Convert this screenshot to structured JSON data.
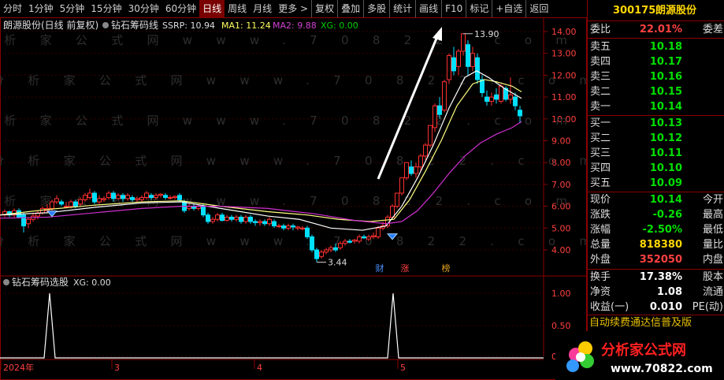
{
  "toolbar": {
    "items": [
      "分时",
      "1分钟",
      "5分钟",
      "15分钟",
      "30分钟",
      "60分钟",
      "日线",
      "周线",
      "月线",
      "更多 >",
      "复权",
      "叠加",
      "多股",
      "统计",
      "画线",
      "F10",
      "标记",
      "+自选",
      "返回"
    ],
    "active": "日线"
  },
  "chart": {
    "header_name": "朗源股份(日线 前复权)",
    "indicator_name": "钻石筹码线",
    "ssrp_label": "SSRP: 10.94",
    "ma1_label": "MA1: 11.24",
    "ma2_label": "MA2: 9.88",
    "xg_label": "XG: 0.00",
    "price_axis": [
      "14.00",
      "13.00",
      "12.00",
      "11.00",
      "10.00",
      "9.00",
      "8.00",
      "7.00",
      "6.00",
      "5.00",
      "4.00"
    ],
    "high_annotation": "13.90",
    "low_annotation": "3.44",
    "event_markers": [
      "财",
      "涨",
      "榜"
    ],
    "watermark": "分析家公式网www.70822.com",
    "colors": {
      "up": "#ff3030",
      "down": "#00e0ff",
      "ma1": "#ffffff",
      "ma2": "#ffff80",
      "ssrp": "#d030d0"
    }
  },
  "sub_chart": {
    "title": "钻石筹码选股",
    "xg_label": "XG: 0.00",
    "axis": [
      "1.00",
      "0.50",
      "0.00"
    ],
    "date_labels": [
      "2024年",
      "3",
      "4",
      "5"
    ]
  },
  "quote": {
    "code": "300175",
    "name": "朗源股份",
    "weibi_label": "委比",
    "weibi_value": "22.01%",
    "weicha_label": "委差",
    "asks": [
      {
        "label": "卖五",
        "price": "10.18"
      },
      {
        "label": "卖四",
        "price": "10.17"
      },
      {
        "label": "卖三",
        "price": "10.16"
      },
      {
        "label": "卖二",
        "price": "10.15"
      },
      {
        "label": "卖一",
        "price": "10.14"
      }
    ],
    "bids": [
      {
        "label": "买一",
        "price": "10.13"
      },
      {
        "label": "买二",
        "price": "10.12"
      },
      {
        "label": "买三",
        "price": "10.11"
      },
      {
        "label": "买四",
        "price": "10.10"
      },
      {
        "label": "买五",
        "price": "10.09"
      }
    ],
    "stats": [
      {
        "k": "现价",
        "v": "10.14",
        "r": "今开",
        "color": "#00e000"
      },
      {
        "k": "涨跌",
        "v": "-0.26",
        "r": "最高",
        "color": "#00e000"
      },
      {
        "k": "涨幅",
        "v": "-2.50%",
        "r": "最低",
        "color": "#00e000"
      },
      {
        "k": "总量",
        "v": "818380",
        "r": "量比",
        "color": "#ffd700"
      },
      {
        "k": "外盘",
        "v": "352050",
        "r": "内盘",
        "color": "#ff4040"
      }
    ],
    "stats2": [
      {
        "k": "换手",
        "v": "17.38%",
        "r": "股本"
      },
      {
        "k": "净资",
        "v": "1.08",
        "r": "流通"
      },
      {
        "k": "收益(一)",
        "v": "0.010",
        "r": "PE(动)"
      }
    ],
    "promo": "自动续费通达信普及版",
    "brand_name": "分析家公式网",
    "brand_url": "www.70822.com"
  }
}
